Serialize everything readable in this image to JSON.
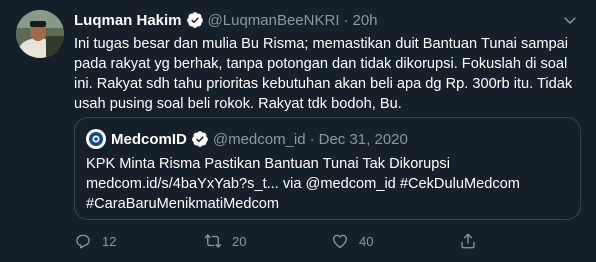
{
  "tweet": {
    "author_name": "Luqman Hakim",
    "handle": "@LuqmanBeeNKRI",
    "separator": "·",
    "time": "20h",
    "body_line1": "Ini tugas besar dan mulia Bu Risma; memastikan duit Bantuan Tunai sampai",
    "body_line2": "pada rakyat yg berhak, tanpa potongan dan tidak dikorupsi. Fokuslah di soal",
    "body_line3": "ini. Rakyat sdh tahu prioritas kebutuhan akan beli apa dg Rp. 300rb itu. Tidak",
    "body_line4": "usah pusing soal beli rokok. Rakyat tdk bodoh, Bu.",
    "verified_icon": "verified-badge-icon",
    "more_icon": "more-options-icon"
  },
  "quoted": {
    "author_name": "MedcomID",
    "handle": "@medcom_id",
    "separator": "·",
    "date": "Dec 31, 2020",
    "line1": "KPK Minta Risma Pastikan Bantuan Tunai Tak Dikorupsi",
    "line2": "medcom.id/s/4baYxYab?s_t... via @medcom_id #CekDuluMedcom",
    "line3": "#CaraBaruMenikmatiMedcom"
  },
  "actions": {
    "reply_count": "12",
    "retweet_count": "20",
    "like_count": "40",
    "reply_icon": "reply-icon",
    "retweet_icon": "retweet-icon",
    "like_icon": "heart-icon",
    "share_icon": "share-icon"
  },
  "colors": {
    "background": "#15202b",
    "text": "#ffffff",
    "secondary_text": "#8899a6",
    "border": "#38444d",
    "verified": "#1da1f2"
  }
}
